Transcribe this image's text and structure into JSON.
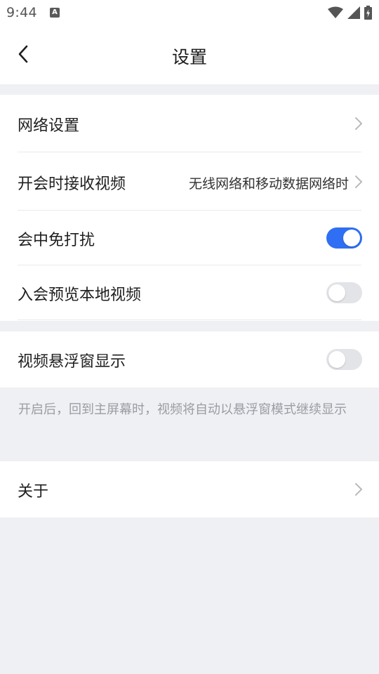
{
  "status_bar": {
    "time": "9:44",
    "notification_icon": "A"
  },
  "header": {
    "title": "设置",
    "back_icon": "chevron-left-icon"
  },
  "group1": {
    "network_settings": {
      "label": "网络设置"
    },
    "receive_video": {
      "label": "开会时接收视频",
      "value": "无线网络和移动数据网络时"
    },
    "do_not_disturb": {
      "label": "会中免打扰",
      "toggle_on": true
    },
    "preview_local_video": {
      "label": "入会预览本地视频",
      "toggle_on": false
    }
  },
  "group2": {
    "floating_window": {
      "label": "视频悬浮窗显示",
      "toggle_on": false
    },
    "hint": "开启后，回到主屏幕时，视频将自动以悬浮窗模式继续显示"
  },
  "group3": {
    "about": {
      "label": "关于"
    }
  },
  "colors": {
    "accent": "#2f6ff3",
    "background": "#eff0f4",
    "toggle_off": "#e3e4e8",
    "hint_text": "#9a9ca2"
  }
}
